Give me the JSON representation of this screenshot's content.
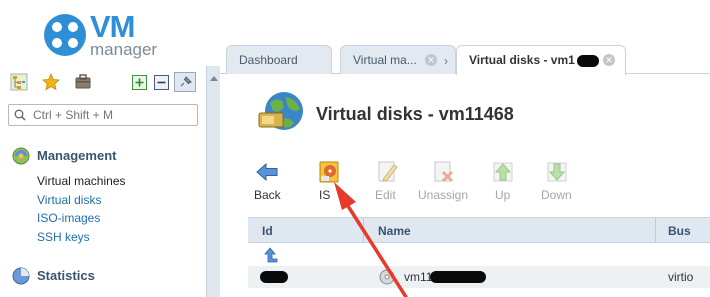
{
  "logo": {
    "word": "VM",
    "sub": "manager"
  },
  "sidebar": {
    "search_placeholder": "Ctrl + Shift + M",
    "sections": [
      {
        "title": "Management",
        "icon": "management-icon"
      },
      {
        "title": "Statistics",
        "icon": "statistics-icon"
      }
    ],
    "items": [
      {
        "label": "Virtual machines",
        "active": true
      },
      {
        "label": "Virtual disks",
        "active": false
      },
      {
        "label": "ISO-images",
        "active": false
      },
      {
        "label": "SSH keys",
        "active": false
      }
    ]
  },
  "tabs": [
    {
      "label": "Dashboard",
      "closable": false,
      "active": false
    },
    {
      "label": "Virtual ma...",
      "closable": true,
      "active": false
    },
    {
      "label": "Virtual disks - vm1",
      "closable": true,
      "active": true
    }
  ],
  "page": {
    "title": "Virtual disks - vm11468"
  },
  "toolbar": [
    {
      "label": "Back",
      "icon": "back-arrow-icon",
      "enabled": true
    },
    {
      "label": "IS",
      "icon": "iso-disk-icon",
      "enabled": true
    },
    {
      "label": "Edit",
      "icon": "edit-icon",
      "enabled": false
    },
    {
      "label": "Unassign",
      "icon": "unassign-icon",
      "enabled": false
    },
    {
      "label": "Up",
      "icon": "up-arrow-icon",
      "enabled": false
    },
    {
      "label": "Down",
      "icon": "down-arrow-icon",
      "enabled": false
    }
  ],
  "table": {
    "columns": [
      "Id",
      "Name",
      "Bus"
    ],
    "rows": [
      {
        "id": "",
        "name": "vm11",
        "bus": "virtio"
      }
    ]
  },
  "colors": {
    "accent": "#2f8fd6",
    "header_bg": "#dfe7f0",
    "link": "#1f6fae",
    "annotation_arrow": "#e8392c"
  }
}
